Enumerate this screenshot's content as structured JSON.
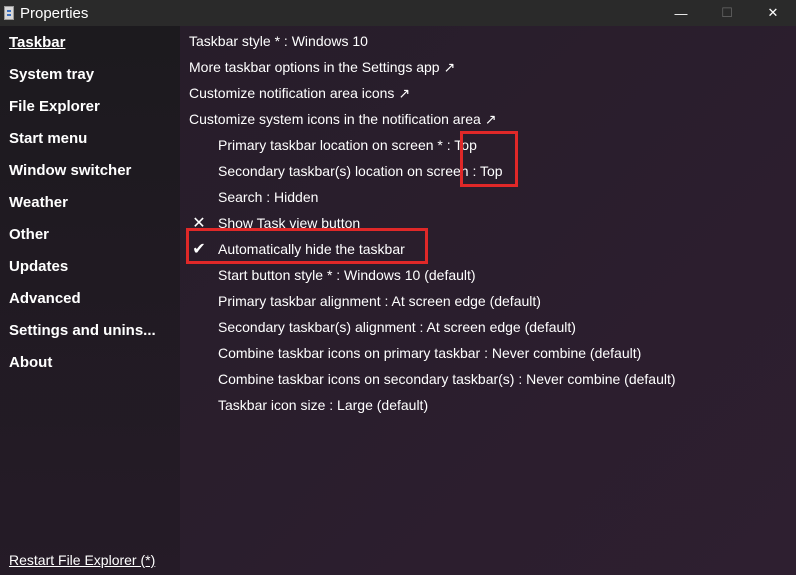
{
  "window": {
    "title": "Properties",
    "minimize_glyph": "—",
    "maximize_glyph": "☐",
    "close_glyph": "✕"
  },
  "sidebar": {
    "items": [
      {
        "label": "Taskbar",
        "active": true
      },
      {
        "label": "System tray"
      },
      {
        "label": "File Explorer"
      },
      {
        "label": "Start menu"
      },
      {
        "label": "Window switcher"
      },
      {
        "label": "Weather"
      },
      {
        "label": "Other"
      },
      {
        "label": "Updates"
      },
      {
        "label": "Advanced"
      },
      {
        "label": "Settings and unins..."
      },
      {
        "label": "About"
      }
    ],
    "restart_link": "Restart File Explorer (*)"
  },
  "main": {
    "options": [
      {
        "text": "Taskbar style * : Windows 10"
      },
      {
        "text": "More taskbar options in the Settings app ↗"
      },
      {
        "text": "Customize notification area icons ↗"
      },
      {
        "text": "Customize system icons in the notification area ↗"
      },
      {
        "text": "Primary taskbar location on screen * : Top"
      },
      {
        "text": "Secondary taskbar(s) location on screen : Top"
      },
      {
        "text": "Search : Hidden"
      },
      {
        "text": "Show Task view button",
        "glyph": "✕"
      },
      {
        "text": "Automatically hide the taskbar",
        "glyph": "✔"
      },
      {
        "text": "Start button style * : Windows 10 (default)"
      },
      {
        "text": "Primary taskbar alignment : At screen edge (default)"
      },
      {
        "text": "Secondary taskbar(s) alignment : At screen edge (default)"
      },
      {
        "text": "Combine taskbar icons on primary taskbar : Never combine (default)"
      },
      {
        "text": "Combine taskbar icons on secondary taskbar(s) : Never combine (default)"
      },
      {
        "text": "Taskbar icon size : Large (default)"
      }
    ]
  },
  "colors": {
    "highlight_box": "#e02828",
    "background": "#2a1d2c",
    "titlebar": "#2a2a2a"
  }
}
